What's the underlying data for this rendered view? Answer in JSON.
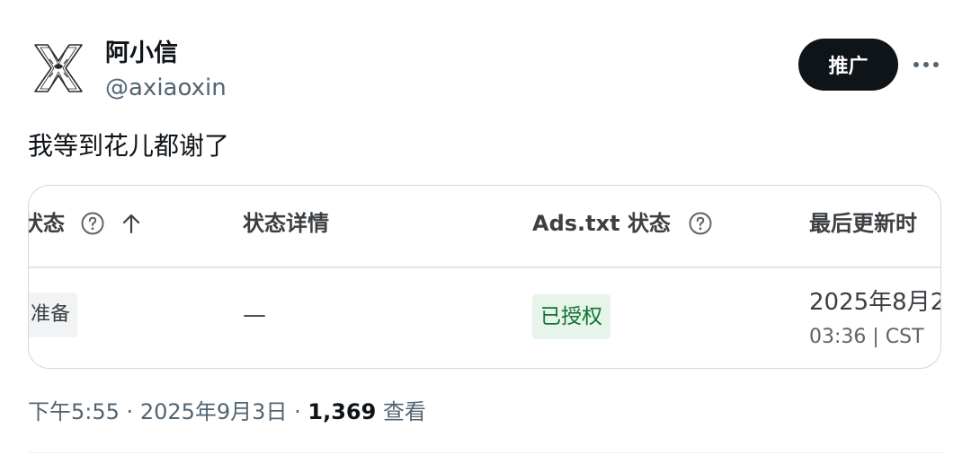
{
  "author": {
    "display_name": "阿小信",
    "handle": "@axiaoxin",
    "avatar_icon": "x-logo-avatar-icon"
  },
  "actions": {
    "promote_label": "推广",
    "more_icon": "more-dots-icon"
  },
  "tweet": {
    "text": "我等到花儿都谢了"
  },
  "media": {
    "columns": [
      {
        "label": "状态",
        "has_help": true,
        "sort": "ascending"
      },
      {
        "label": "状态详情",
        "has_help": false
      },
      {
        "label": "Ads.txt 状态",
        "has_help": true
      },
      {
        "label": "最后更新时"
      }
    ],
    "row": {
      "status": "准备",
      "detail": "—",
      "ads_txt_status": "已授权",
      "updated_date": "2025年8月2",
      "updated_time": "03:36 | CST"
    },
    "colors": {
      "authorized_bg": "#e6f4ea",
      "authorized_text": "#137333",
      "status_chip_bg": "#f1f3f4"
    }
  },
  "meta": {
    "time": "下午5:55",
    "separator": "·",
    "date": "2025年9月3日",
    "views_count": "1,369",
    "views_label": "查看"
  }
}
